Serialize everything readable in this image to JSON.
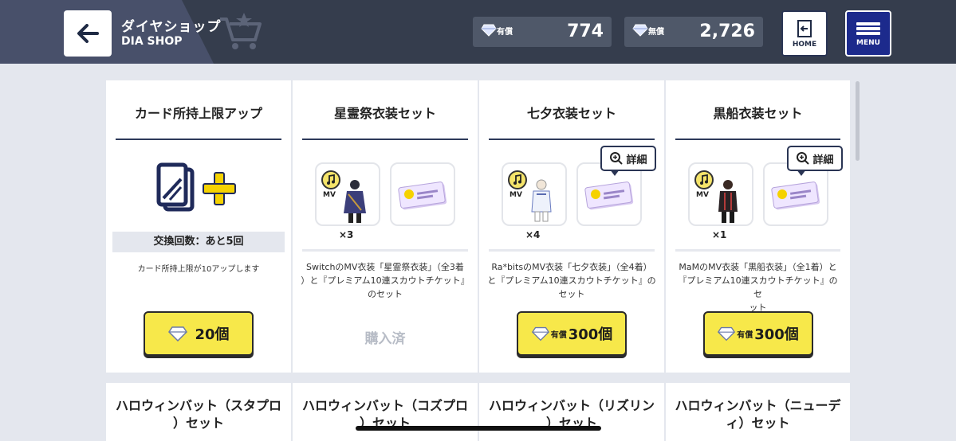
{
  "header": {
    "title": "ダイヤショップ",
    "subtitle": "DIA SHOP",
    "paid": {
      "label": "有償",
      "amount": "774"
    },
    "free": {
      "label": "無償",
      "amount": "2,726"
    },
    "home_label": "HOME",
    "menu_label": "MENU"
  },
  "cards": [
    {
      "title": "カード所持上限アップ",
      "limit_text": "交換回数：あと5回",
      "description": "カード所持上限が10アップします",
      "price": "20個"
    },
    {
      "title": "星霊祭衣装セット",
      "qty": "×3",
      "desc_lines": [
        "SwitchのMV衣装「星霊祭衣装」（全3着",
        "）と『プレミアム10連スカウトチケット』",
        "のセット"
      ],
      "status": "購入済"
    },
    {
      "title": "七夕衣装セット",
      "qty": "×4",
      "detail": "詳細",
      "desc_lines": [
        "Ra*bitsのMV衣装「七夕衣装」（全4着）",
        "と『プレミアム10連スカウトチケット』の",
        "セット"
      ],
      "price_tag": "有償",
      "price": "300個"
    },
    {
      "title": "黒船衣装セット",
      "qty": "×1",
      "detail": "詳細",
      "desc_lines": [
        "MaMのMV衣装「黒船衣装」（全1着）と",
        "『プレミアム10連スカウトチケット』のセ",
        "ット"
      ],
      "price_tag": "有償",
      "price": "300個"
    }
  ],
  "row2": [
    {
      "line1": "ハロウィンバット（スタプロ",
      "line2": "）セット"
    },
    {
      "line1": "ハロウィンバット（コズプロ",
      "line2": "）セット"
    },
    {
      "line1": "ハロウィンバット（リズリン",
      "line2": "）セット"
    },
    {
      "line1": "ハロウィンバット（ニューデ",
      "line2": "ィ）セット"
    }
  ],
  "icons": {
    "back": "back-arrow-icon",
    "cart": "cart-icon",
    "diamond": "diamond-icon",
    "home": "exit-door-icon",
    "menu": "hamburger-icon",
    "mv": "music-note-icon",
    "ticket": "scout-ticket-icon",
    "card_plus": "card-plus-icon",
    "magnifier": "zoom-plus-icon"
  },
  "colors": {
    "header_bg": "#353d4d",
    "price_button": "#f7e84a",
    "menu_bg": "#1c2a8c",
    "accent_yellow": "#f5d200"
  }
}
